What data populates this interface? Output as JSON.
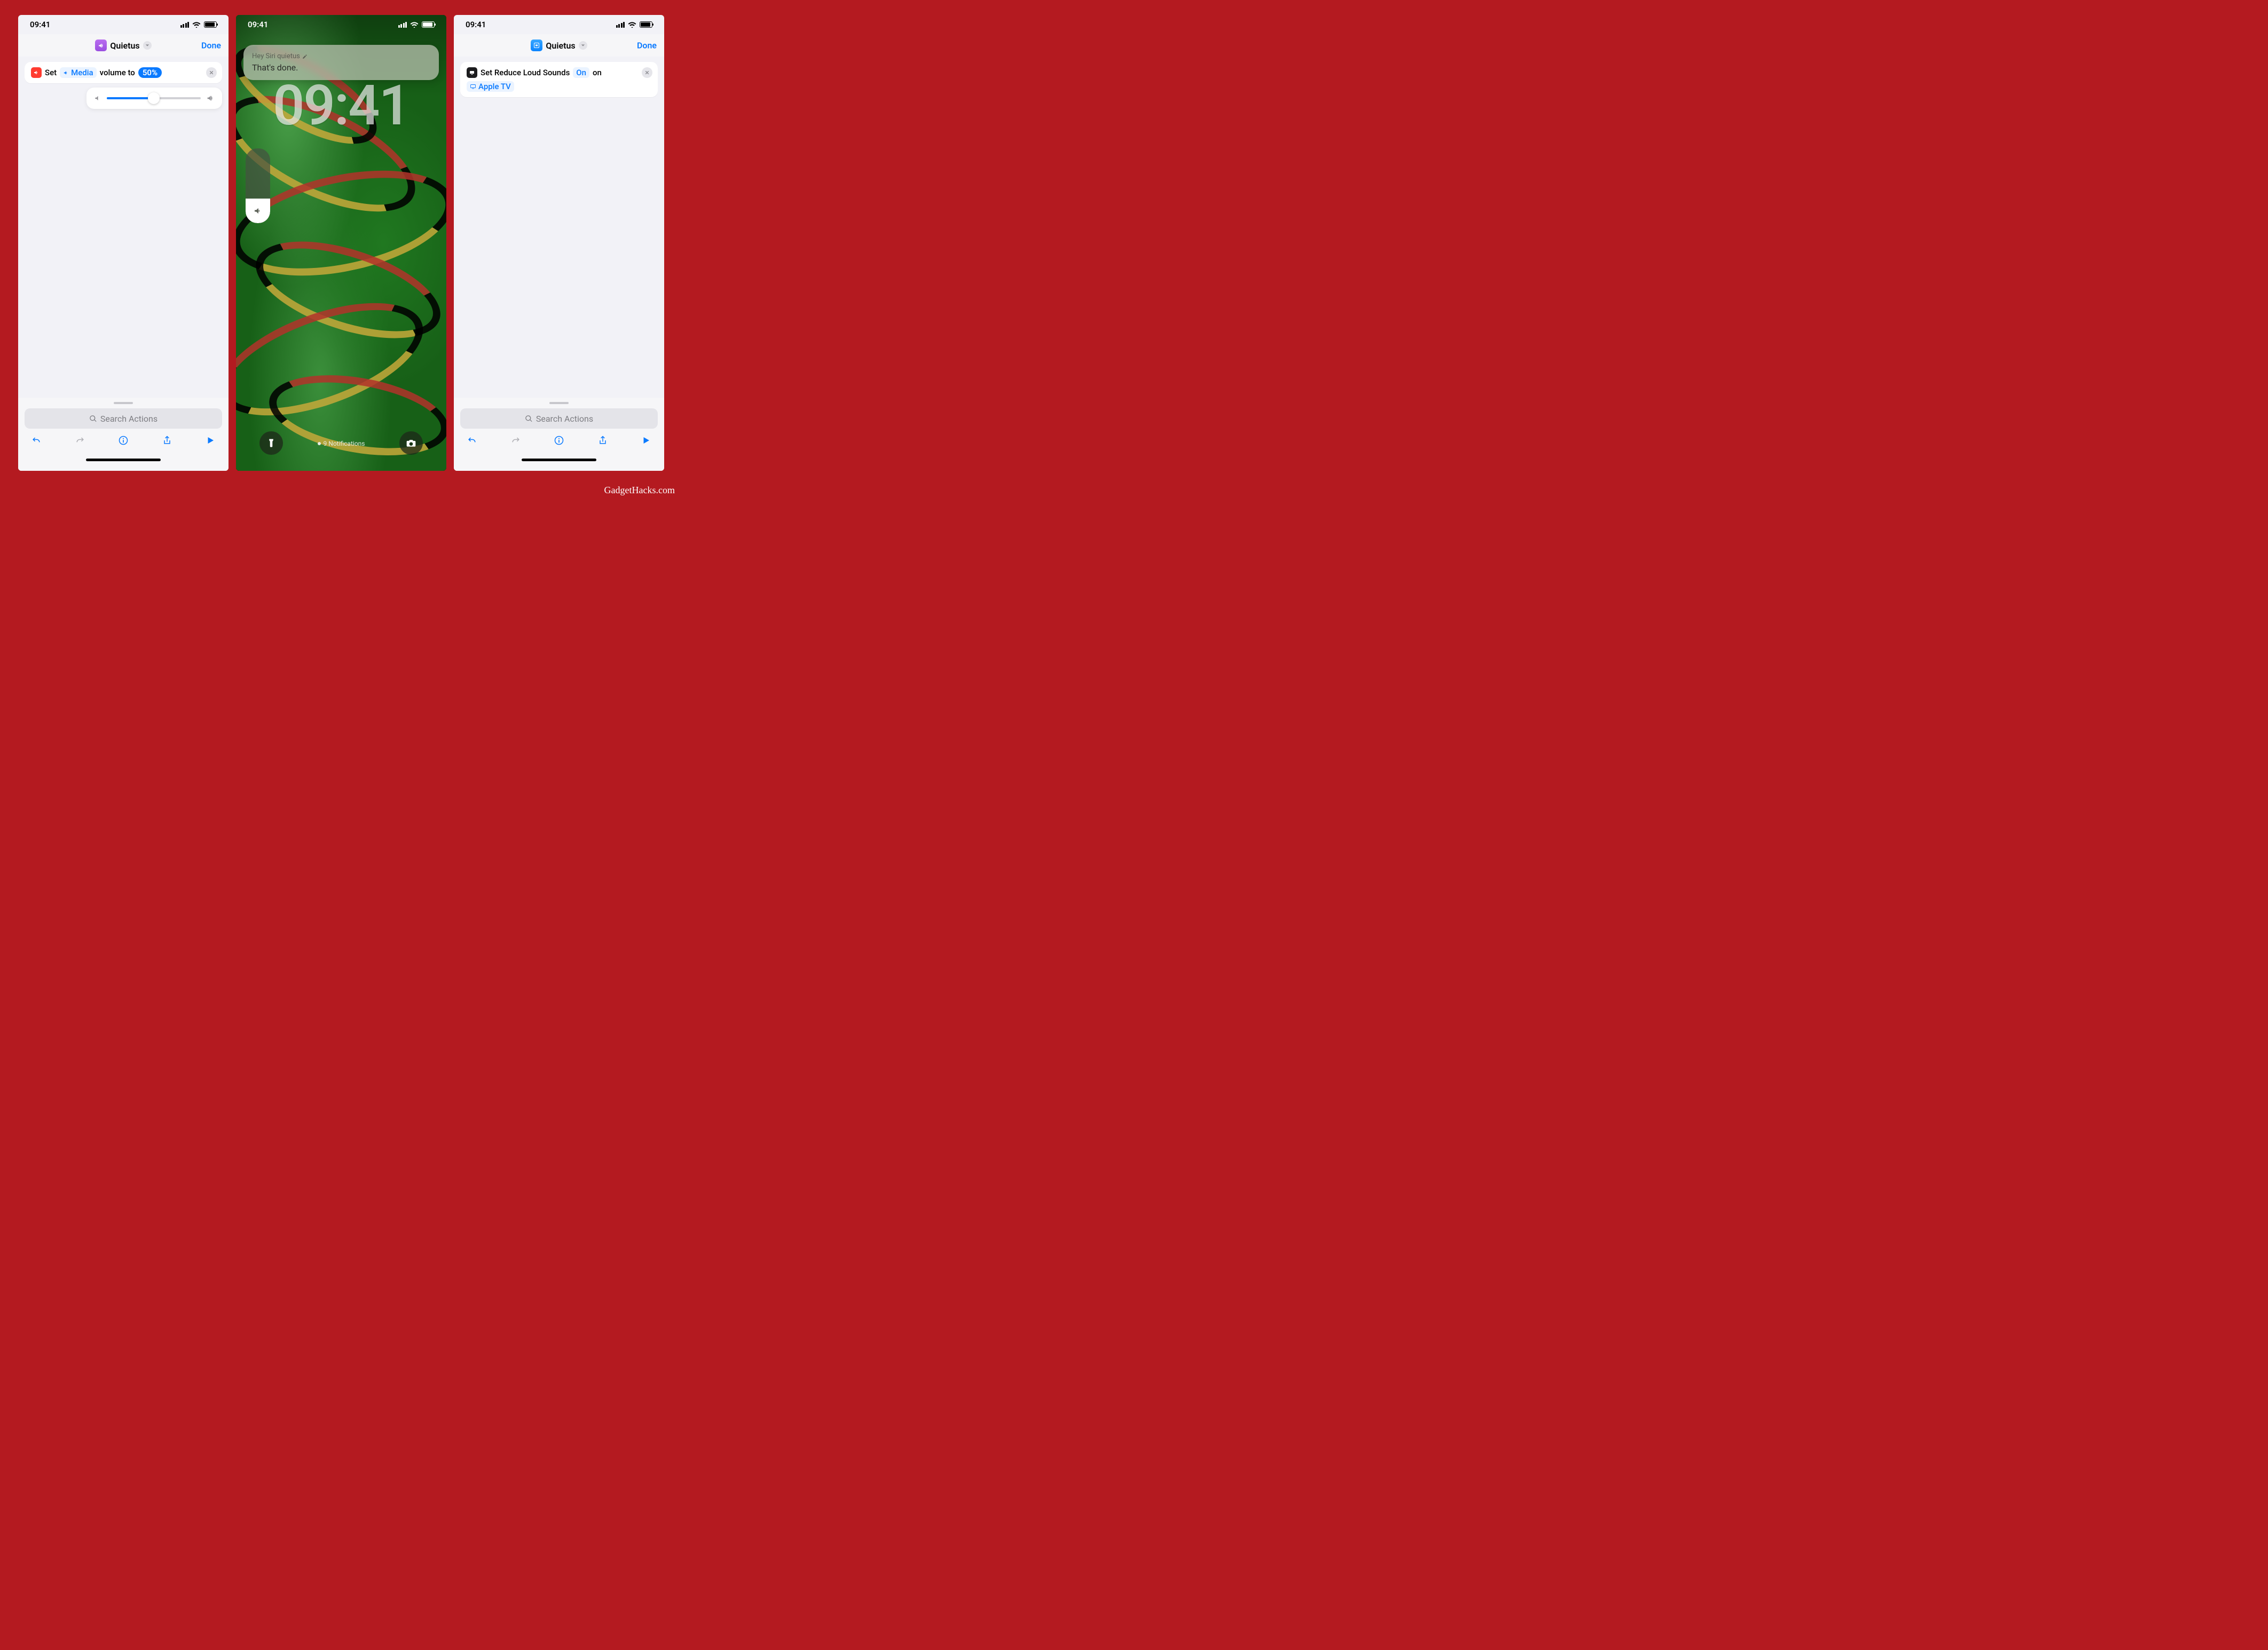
{
  "statusbar": {
    "time": "09:41"
  },
  "phoneA": {
    "title": "Quietus",
    "done": "Done",
    "action": {
      "prefix": "Set",
      "param_label": "Media",
      "mid": "volume to",
      "value": "50%"
    },
    "search_placeholder": "Search Actions"
  },
  "phoneB": {
    "siri_header": "Hey Siri quietus",
    "siri_body": "That's done.",
    "bigclock": "09:41",
    "notifications": "9 Notifications"
  },
  "phoneC": {
    "title": "Quietus",
    "done": "Done",
    "action": {
      "line1_a": "Set Reduce Loud Sounds",
      "line1_pill": "On",
      "line1_b": "on",
      "device": "Apple TV"
    },
    "search_placeholder": "Search Actions"
  },
  "watermark": "GadgetHacks.com"
}
